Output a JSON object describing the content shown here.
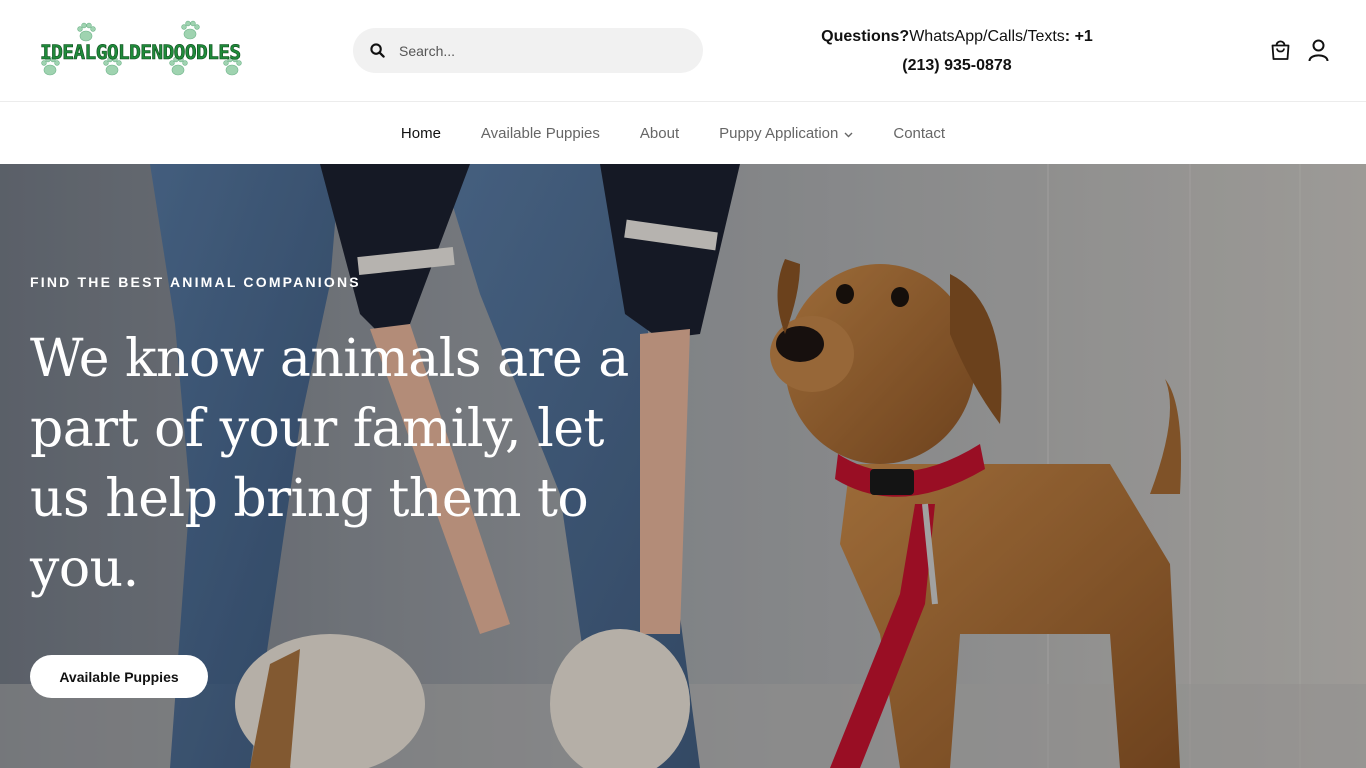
{
  "header": {
    "logo_text": "IDEALGOLDENDOODLES",
    "search": {
      "placeholder": "Search..."
    },
    "contact": {
      "label": "Questions?",
      "text": "WhatsApp/Calls/Texts",
      "phone_prefix": ": +1",
      "phone": "(213) 935-0878"
    },
    "icons": [
      "cart-icon",
      "account-icon"
    ]
  },
  "nav": {
    "items": [
      {
        "label": "Home",
        "active": true
      },
      {
        "label": "Available Puppies"
      },
      {
        "label": "About"
      },
      {
        "label": "Puppy Application",
        "has_dropdown": true
      },
      {
        "label": "Contact"
      }
    ]
  },
  "hero": {
    "eyebrow": "FIND THE BEST ANIMAL COMPANIONS",
    "headline": "We know animals are a part of your family, let us help bring them to you.",
    "cta_label": "Available Puppies"
  },
  "colors": {
    "logo_green": "#1f8a3a",
    "paw_mint": "#9fd3b0",
    "search_bg": "#f1f1f1",
    "collar_red": "#c4122f",
    "dog_brown": "#b5763a"
  }
}
